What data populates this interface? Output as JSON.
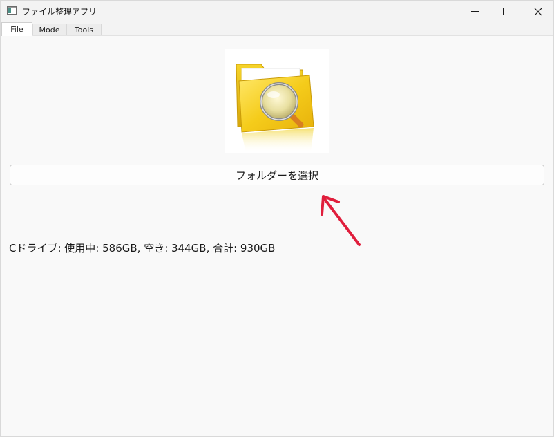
{
  "window": {
    "title": "ファイル整理アプリ",
    "icon": "app-window-icon"
  },
  "tabs": [
    {
      "label": "File",
      "active": true
    },
    {
      "label": "Mode",
      "active": false
    },
    {
      "label": "Tools",
      "active": false
    }
  ],
  "main": {
    "image": {
      "icon": "folder-magnifier-icon"
    },
    "select_button_label": "フォルダーを選択",
    "annotation": {
      "icon": "red-arrow-icon",
      "color": "#e01e3c"
    },
    "drive_info": "Cドライブ: 使用中: 586GB, 空き: 344GB, 合計: 930GB"
  }
}
